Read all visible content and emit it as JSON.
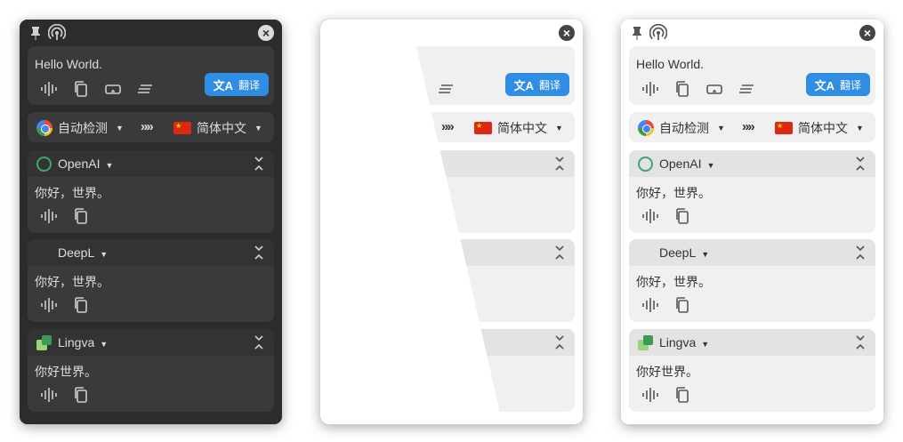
{
  "source": {
    "text": "Hello World.",
    "translate_label": "翻译",
    "translate_glyph": "文A",
    "icons": [
      "pin-icon",
      "radar-icon",
      "close-icon",
      "tts-icon",
      "copy-icon",
      "line-break-icon",
      "clear-icon"
    ]
  },
  "languages": {
    "from": "自动检测",
    "swap": "»",
    "to": "简体中文"
  },
  "services": [
    {
      "name": "OpenAI",
      "result": "你好，世界。",
      "icon": "openai-icon"
    },
    {
      "name": "DeepL",
      "result": "你好，世界。",
      "icon": "deepl-icon"
    },
    {
      "name": "Lingva",
      "result": "你好世界。",
      "icon": "lingva-icon"
    }
  ],
  "colors": {
    "accent": "#2f8de4",
    "dark_bg": "#2c2c2c",
    "light_bg": "#ffffff",
    "openai_green": "#3ca86e",
    "deepl_navy": "#0f2b46",
    "flag_red": "#de2910"
  }
}
